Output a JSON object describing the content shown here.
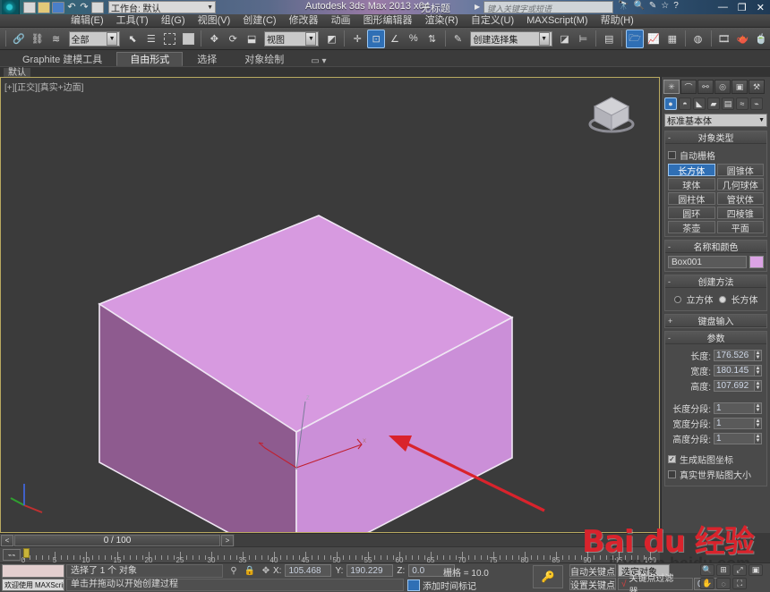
{
  "titlebar": {
    "app_title": "Autodesk 3ds Max  2013 x64",
    "document_title": "无标题",
    "workspace_label": "工作台: 默认",
    "search_placeholder": "键入关键字或短语",
    "help_icon": "question-icon",
    "minimize": "—",
    "maximize": "❐",
    "close": "✕"
  },
  "menu": {
    "items": [
      {
        "label": "编辑(E)"
      },
      {
        "label": "工具(T)"
      },
      {
        "label": "组(G)"
      },
      {
        "label": "视图(V)"
      },
      {
        "label": "创建(C)"
      },
      {
        "label": "修改器"
      },
      {
        "label": "动画"
      },
      {
        "label": "图形编辑器"
      },
      {
        "label": "渲染(R)"
      },
      {
        "label": "自定义(U)"
      },
      {
        "label": "MAXScript(M)"
      },
      {
        "label": "帮助(H)"
      }
    ]
  },
  "toolbar": {
    "selection_filter": "全部",
    "reference_coord": "视图",
    "named_selection_set": "创建选择集",
    "snap_percent": "3"
  },
  "ribbon": {
    "tabs": [
      {
        "label": "Graphite 建模工具",
        "active": false
      },
      {
        "label": "自由形式",
        "active": true
      },
      {
        "label": "选择",
        "active": false
      },
      {
        "label": "对象绘制",
        "active": false
      }
    ],
    "subtab": "默认"
  },
  "viewport": {
    "label": "[+][正交][真实+边面]",
    "object_top_color": "#d79ae0",
    "object_right_color": "#cb8fd8",
    "object_left_color": "#8e5b8f",
    "edge_color": "#efe6f3",
    "background": "#3b3b3b",
    "gizmo_color": "#c02030",
    "annotation_arrow_color": "#d9232c",
    "axis_labels": {
      "z": "Z",
      "x": "X"
    }
  },
  "command_panel": {
    "tabs": [
      {
        "name": "create-tab",
        "glyph": "✳",
        "active": true
      },
      {
        "name": "modify-tab",
        "glyph": "⌒",
        "active": false
      },
      {
        "name": "hierarchy-tab",
        "glyph": "⚯",
        "active": false
      },
      {
        "name": "motion-tab",
        "glyph": "◎",
        "active": false
      },
      {
        "name": "display-tab",
        "glyph": "▣",
        "active": false
      },
      {
        "name": "utilities-tab",
        "glyph": "⚒",
        "active": false
      }
    ],
    "category_icons": [
      {
        "name": "geometry-icon",
        "glyph": "●",
        "active": true
      },
      {
        "name": "shapes-icon",
        "glyph": "◓",
        "active": false
      },
      {
        "name": "lights-icon",
        "glyph": "◣",
        "active": false
      },
      {
        "name": "cameras-icon",
        "glyph": "🎥",
        "active": false
      },
      {
        "name": "helpers-icon",
        "glyph": "▤",
        "active": false
      },
      {
        "name": "space-warps-icon",
        "glyph": "≈",
        "active": false
      },
      {
        "name": "systems-icon",
        "glyph": "⌁",
        "active": false
      }
    ],
    "subcategory": "标准基本体",
    "object_type": {
      "title": "对象类型",
      "autogrid_label": "自动栅格",
      "autogrid_checked": false,
      "buttons": [
        {
          "label": "长方体",
          "active": true
        },
        {
          "label": "圆锥体",
          "active": false
        },
        {
          "label": "球体",
          "active": false
        },
        {
          "label": "几何球体",
          "active": false
        },
        {
          "label": "圆柱体",
          "active": false
        },
        {
          "label": "管状体",
          "active": false
        },
        {
          "label": "圆环",
          "active": false
        },
        {
          "label": "四棱锥",
          "active": false
        },
        {
          "label": "茶壶",
          "active": false
        },
        {
          "label": "平面",
          "active": false
        }
      ]
    },
    "name_color": {
      "title": "名称和颜色",
      "name_value": "Box001",
      "color_swatch": "#dba3e4"
    },
    "creation_method": {
      "title": "创建方法",
      "options": [
        {
          "label": "立方体",
          "selected": false
        },
        {
          "label": "长方体",
          "selected": true
        }
      ]
    },
    "keyboard_entry": {
      "title": "键盘输入"
    },
    "parameters": {
      "title": "参数",
      "fields": [
        {
          "label": "长度:",
          "value": "176.526"
        },
        {
          "label": "宽度:",
          "value": "180.145"
        },
        {
          "label": "高度:",
          "value": "107.692"
        },
        {
          "label": "长度分段:",
          "value": "1"
        },
        {
          "label": "宽度分段:",
          "value": "1"
        },
        {
          "label": "高度分段:",
          "value": "1"
        }
      ],
      "checkboxes": [
        {
          "label": "生成贴图坐标",
          "checked": true
        },
        {
          "label": "真实世界贴图大小",
          "checked": false
        }
      ]
    }
  },
  "time_slider": {
    "current": "0 / 100",
    "prev_label": "<",
    "next_label": ">"
  },
  "track_bar": {
    "tick_labels": [
      "0",
      "5",
      "10",
      "15",
      "20",
      "25",
      "30",
      "35",
      "40",
      "45",
      "50",
      "55",
      "60",
      "65",
      "70",
      "75",
      "80",
      "85",
      "90",
      "95",
      "100"
    ]
  },
  "status_bar": {
    "maxscript_welcome": "欢迎使用",
    "maxscript_tag": "MAXScript",
    "selection_status": "选择了 1 个 对象",
    "prompt": "单击并拖动以开始创建过程",
    "coords": [
      {
        "label": "X:",
        "value": "105.468"
      },
      {
        "label": "Y:",
        "value": "190.229"
      },
      {
        "label": "Z:",
        "value": "0.0"
      }
    ],
    "grid_info": "栅格 = 10.0",
    "add_time_tag": "添加时间标记",
    "auto_key": "自动关键点",
    "set_key": "设置关键点",
    "selection_set": "选定对象",
    "key_filters": "关键点过滤器...",
    "frame_value": "0"
  },
  "watermark": {
    "brand": "Bai du 经验",
    "url": "jingyan.baidu.com"
  }
}
